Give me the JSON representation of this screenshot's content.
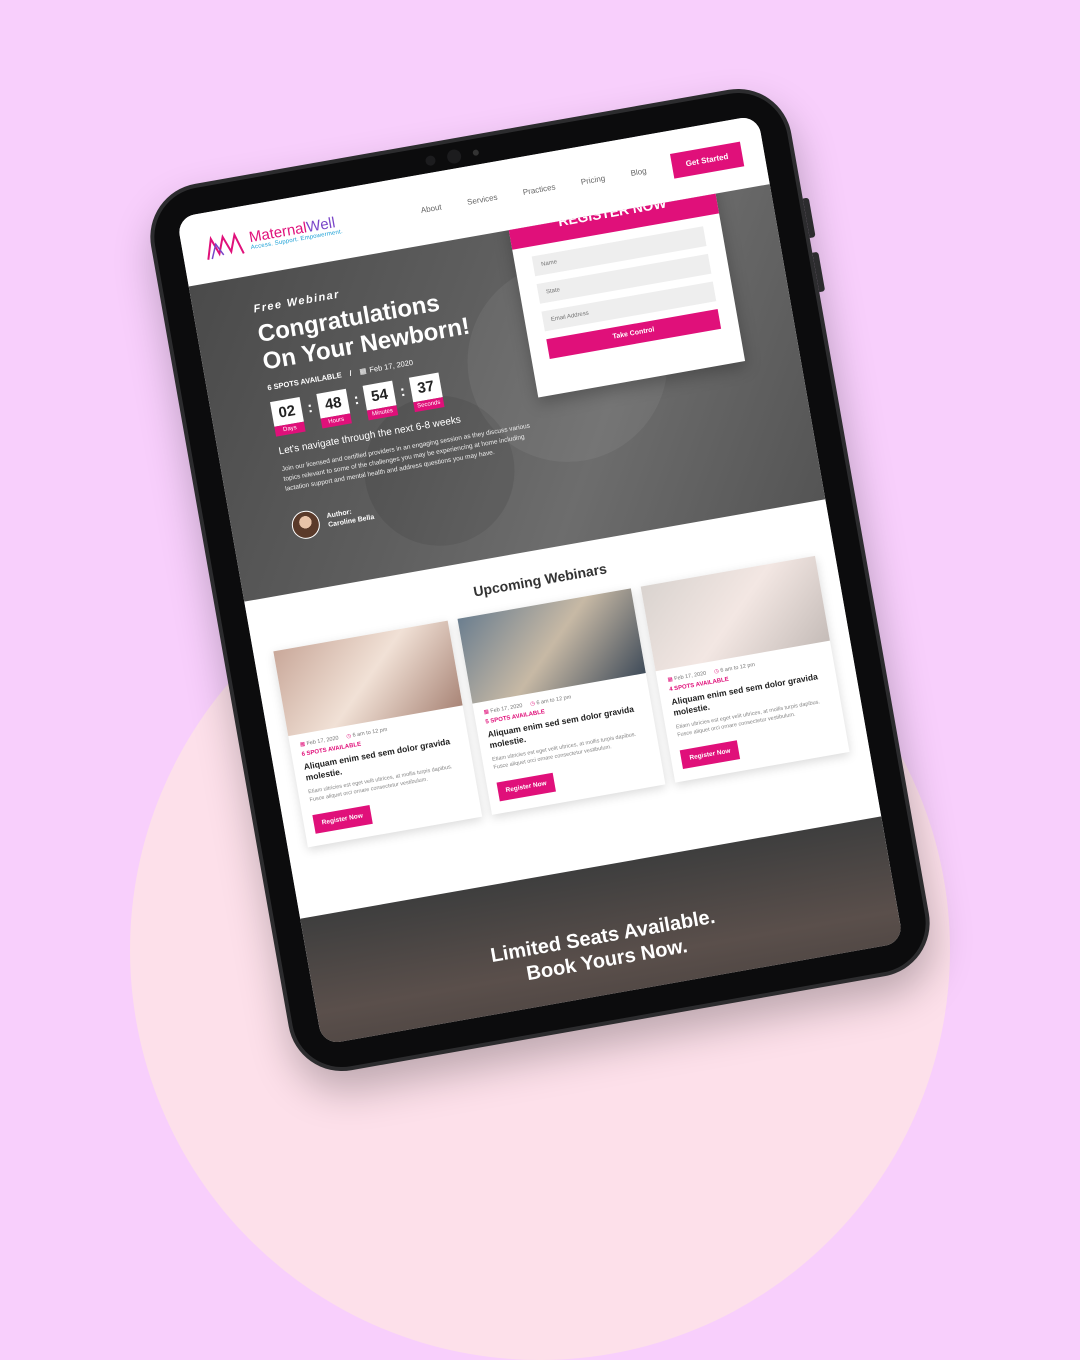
{
  "nav": {
    "logo_name_a": "Maternal",
    "logo_name_b": "Well",
    "logo_tagline": "Access. Support. Empowerment.",
    "links": [
      "About",
      "Services",
      "Practices",
      "Pricing",
      "Blog"
    ],
    "cta": "Get Started"
  },
  "hero": {
    "label": "Free Webinar",
    "title_line1": "Congratulations",
    "title_line2": "On Your Newborn!",
    "spots": "6 SPOTS AVAILABLE",
    "separator": "/",
    "date": "Feb 17, 2020",
    "countdown": [
      {
        "value": "02",
        "label": "Days"
      },
      {
        "value": "48",
        "label": "Hours"
      },
      {
        "value": "54",
        "label": "Minutes"
      },
      {
        "value": "37",
        "label": "Seconds"
      }
    ],
    "subtitle": "Let's navigate through the next 6-8 weeks",
    "description": "Join our licensed and certified providers in an engaging session as they discuss various topics relevant to some of the challenges you may be experiencing at home including lactation support and mental health and address questions you may have.",
    "author_label": "Author:",
    "author_name": "Caroline Bella"
  },
  "register": {
    "title": "REGISTER NOW",
    "fields": [
      "Name",
      "State",
      "Email Address"
    ],
    "button": "Take Control"
  },
  "upcoming": {
    "title": "Upcoming Webinars",
    "cards": [
      {
        "date": "Feb 17, 2020",
        "time": "6 am to 12 pm",
        "spots": "6 SPOTS AVAILABLE",
        "title": "Aliquam enim sed sem dolor gravida molestie.",
        "desc": "Etiam ultricies est eget velit ultrices, at mollis turpis dapibus. Fusce aliquet orci ornare consectetur vestibulum.",
        "button": "Register Now"
      },
      {
        "date": "Feb 17, 2020",
        "time": "6 am to 12 pm",
        "spots": "5 SPOTS AVAILABLE",
        "title": "Aliquam enim sed sem dolor gravida molestie.",
        "desc": "Etiam ultricies est eget velit ultrices, at mollis turpis dapibus. Fusce aliquet orci ornare consectetur vestibulum.",
        "button": "Register Now"
      },
      {
        "date": "Feb 17, 2020",
        "time": "6 am to 12 pm",
        "spots": "4 SPOTS AVAILABLE",
        "title": "Aliquam enim sed sem dolor gravida molestie.",
        "desc": "Etiam ultricies est eget velit ultrices, at mollis turpis dapibus. Fusce aliquet orci ornare consectetur vestibulum.",
        "button": "Register Now"
      }
    ]
  },
  "cta": {
    "line1": "Limited Seats Available.",
    "line2": "Book Yours Now."
  },
  "colors": {
    "accent": "#e0107a",
    "background": "#f8cffc",
    "circle": "#fde0ea"
  }
}
